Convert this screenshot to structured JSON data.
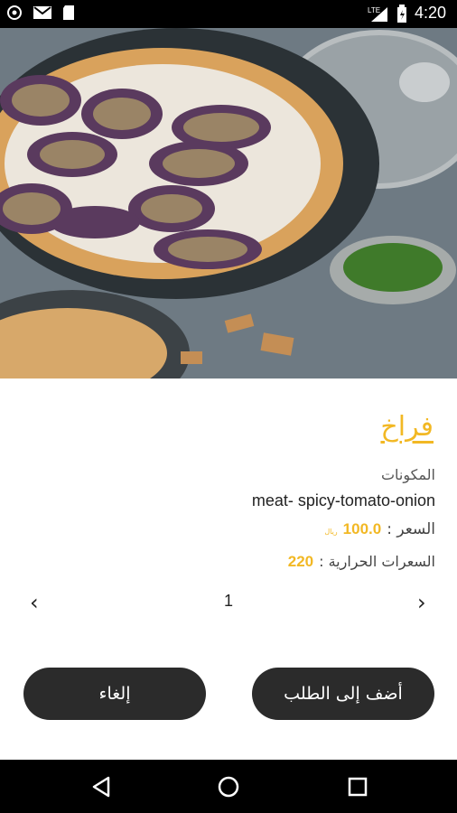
{
  "status_bar": {
    "time": "4:20",
    "network": "LTE",
    "icons": [
      "photos-icon",
      "gmail-icon",
      "clipboard-icon",
      "signal-icon",
      "battery-icon"
    ]
  },
  "dish": {
    "name": "فراخ",
    "ingredients_label": "المكونات",
    "ingredients": "meat- spicy-tomato-onion",
    "price_label": "السعر :",
    "price": "100.0",
    "currency": "ريال",
    "calories_label": "السعرات الحرارية :",
    "calories": "220"
  },
  "stepper": {
    "quantity": "1",
    "prev_icon": "‹",
    "next_icon": "›"
  },
  "actions": {
    "add_to_order": "أضف إلى الطلب",
    "cancel": "إلغاء"
  },
  "colors": {
    "accent": "#f2b824",
    "button": "#2b2b2b"
  }
}
